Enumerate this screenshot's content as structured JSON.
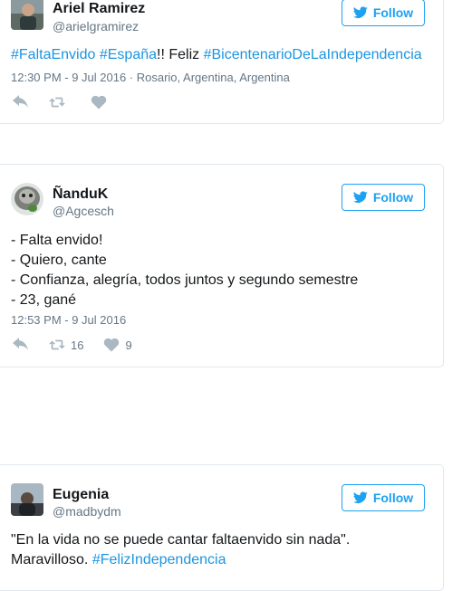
{
  "tweets": [
    {
      "name": "Ariel Ramirez",
      "handle": "@arielgramirez",
      "follow_label": "Follow",
      "text_parts": [
        {
          "tag": "#FaltaEnvido"
        },
        {
          "plain": " "
        },
        {
          "tag": "#España"
        },
        {
          "plain": "!! Feliz "
        },
        {
          "tag": "#BicentenarioDeLaIndependencia"
        }
      ],
      "meta": "12:30 PM - 9 Jul 2016 · Rosario, Argentina, Argentina",
      "retweets": "",
      "likes": ""
    },
    {
      "name": "ÑanduK",
      "handle": "@Agcesch",
      "follow_label": "Follow",
      "lines": [
        "- Falta envido!",
        "- Quiero, cante",
        "- Confianza, alegría, todos juntos y segundo semestre",
        "- 23, gané"
      ],
      "meta": "12:53 PM - 9 Jul 2016",
      "retweets": "16",
      "likes": "9"
    },
    {
      "name": "Eugenia",
      "handle": "@madbydm",
      "follow_label": "Follow",
      "line1": "\"En la vida no se puede cantar faltaenvido sin nada\".",
      "line2_plain": "Maravilloso. ",
      "line2_tag": "#FelizIndependencia"
    }
  ],
  "colors": {
    "accent": "#1da1f2",
    "hashtag": "#1b95e0",
    "muted": "#657786",
    "icon": "#aab8c2",
    "border": "#e1e8ed"
  },
  "icons": [
    "twitter-bird-icon",
    "reply-icon",
    "retweet-icon",
    "heart-icon"
  ]
}
